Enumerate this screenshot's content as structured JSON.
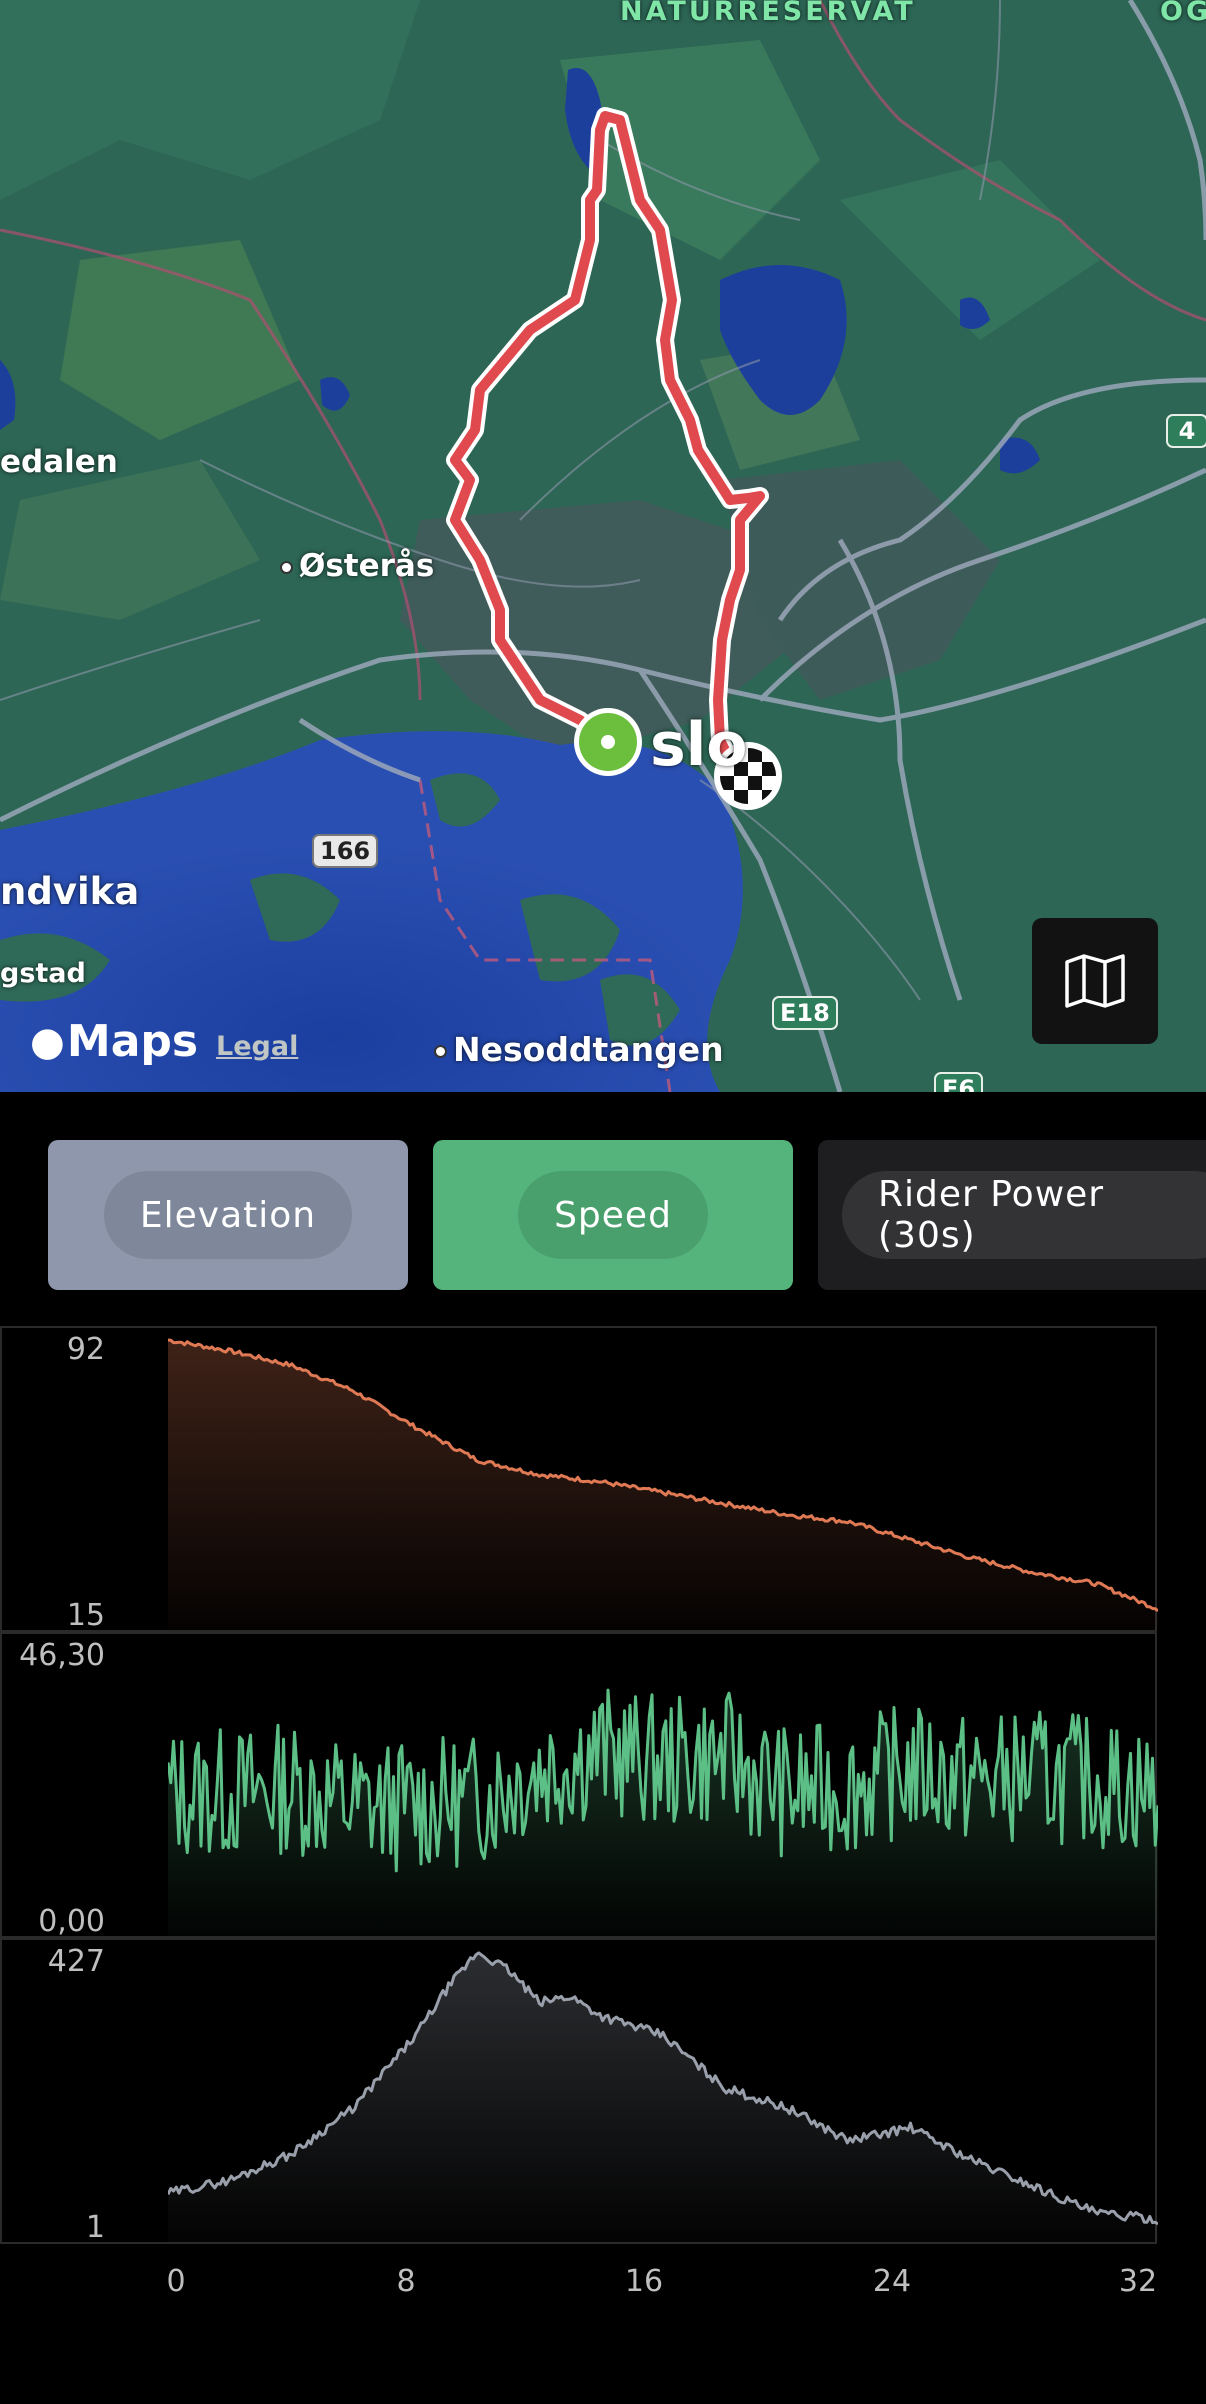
{
  "map": {
    "labels": {
      "naturreservat": "NATURRESERVAT",
      "og": "OG",
      "edalen": "edalen",
      "osteras": "Østerås",
      "oslo": "slo",
      "andvika": "ndvika",
      "gstad": "gstad",
      "nesoddtangen": "Nesoddtangen"
    },
    "road_badges": {
      "r4": "4",
      "r166": "166",
      "e18": "E18",
      "e6": "E6"
    },
    "logo_text": "Maps",
    "legal_link": "Legal",
    "map_button_icon": "map-icon",
    "route_color": "#e04a4f",
    "start_marker_color": "#6bbf3c"
  },
  "tabs": {
    "elevation": "Elevation",
    "speed": "Speed",
    "rider_power": "Rider Power (30s)"
  },
  "charts": {
    "elevation": {
      "ymax": "92",
      "ymin": "15",
      "color": "#e07a55"
    },
    "speed": {
      "ymax": "46,30",
      "ymin": "0,00",
      "color": "#5cc086"
    },
    "power": {
      "ymax": "427",
      "ymin": "1",
      "color": "#9aa0ab"
    },
    "x_ticks": [
      "0",
      "8",
      "16",
      "24",
      "32"
    ]
  },
  "chart_data": [
    {
      "type": "area",
      "series": [
        {
          "name": "Elevation",
          "x": [
            0,
            2,
            4,
            6,
            8,
            10,
            12,
            14,
            16,
            18,
            20,
            22,
            24,
            26,
            28,
            30,
            32
          ],
          "values": [
            92,
            89,
            85,
            78,
            68,
            59,
            55,
            53,
            50,
            47,
            44,
            42,
            37,
            32,
            28,
            25,
            18
          ]
        }
      ],
      "ylim": [
        15,
        92
      ],
      "xlim": [
        0,
        32
      ]
    },
    {
      "type": "line",
      "series": [
        {
          "name": "Speed",
          "x": [
            0,
            2,
            4,
            6,
            8,
            10,
            12,
            14,
            16,
            18,
            20,
            22,
            24,
            26,
            28,
            30,
            32
          ],
          "values": [
            22,
            22,
            23,
            20,
            20,
            21,
            26,
            29,
            27,
            28,
            22,
            23,
            26,
            24,
            25,
            24,
            22
          ]
        }
      ],
      "ylim": [
        0,
        46.3
      ],
      "xlim": [
        0,
        32
      ]
    },
    {
      "type": "area",
      "series": [
        {
          "name": "Rider Power (30s)",
          "x": [
            0,
            2,
            4,
            6,
            8,
            9,
            10,
            11,
            12,
            13,
            14,
            16,
            18,
            20,
            22,
            24,
            26,
            28,
            30,
            32
          ],
          "values": [
            60,
            80,
            120,
            190,
            300,
            370,
            427,
            400,
            350,
            360,
            330,
            300,
            220,
            190,
            140,
            160,
            110,
            70,
            30,
            20
          ]
        }
      ],
      "ylim": [
        1,
        427
      ],
      "xlim": [
        0,
        32
      ]
    }
  ]
}
